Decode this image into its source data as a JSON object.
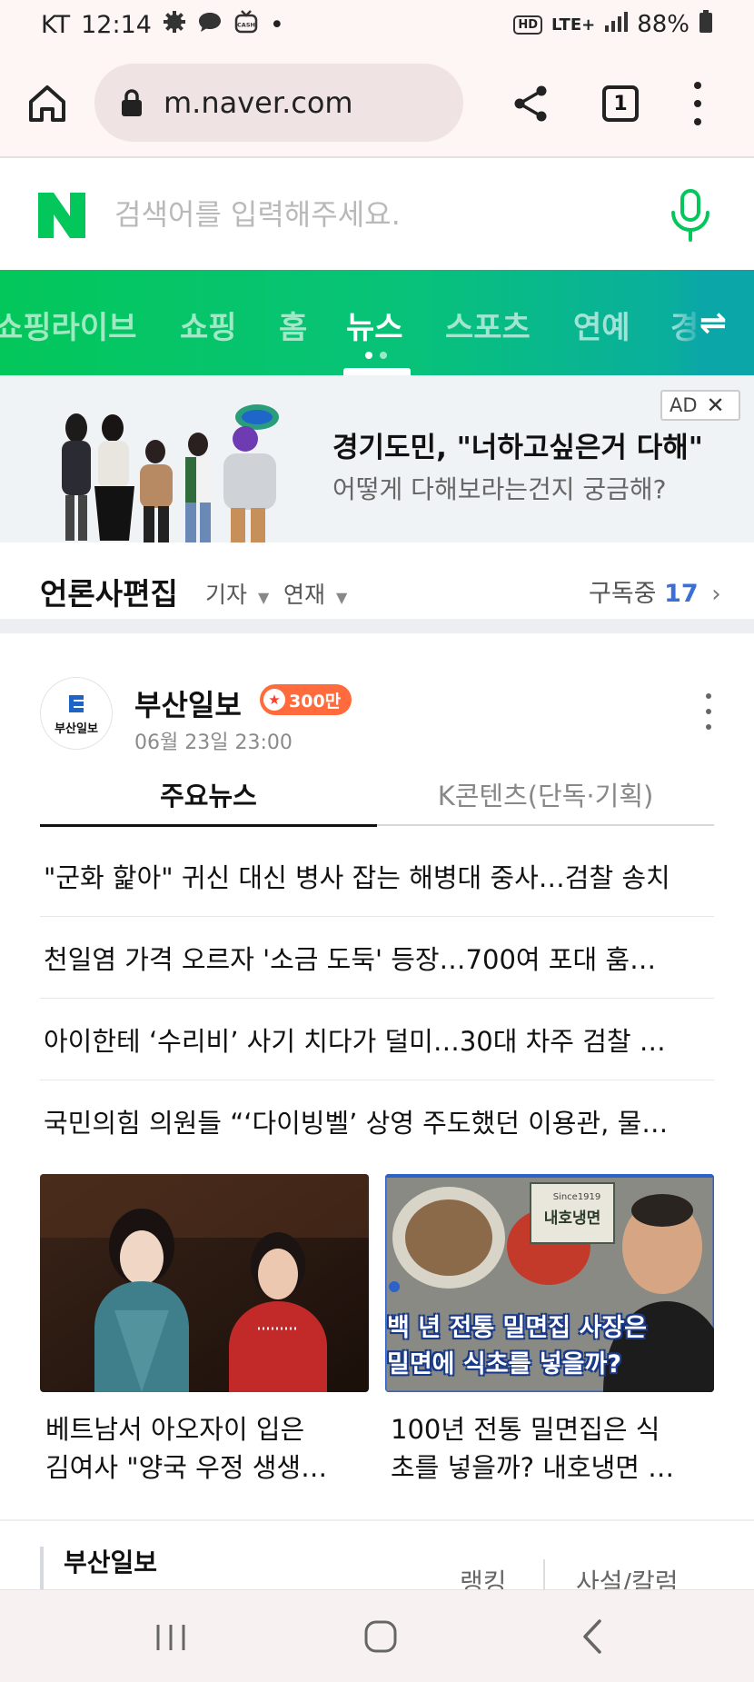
{
  "status_bar": {
    "carrier": "KT",
    "time": "12:14",
    "indicator_icons": [
      "gear-icon",
      "chat-icon",
      "cash-tv-icon"
    ],
    "notification_dot": "•",
    "hd_badge": "HD",
    "network": "LTE+",
    "battery": "88%"
  },
  "browser": {
    "url": "m.naver.com",
    "tab_count": "1"
  },
  "search": {
    "placeholder": "검색어를 입력해주세요."
  },
  "nav": {
    "items": [
      {
        "label": "쇼핑라이브",
        "active": false
      },
      {
        "label": "쇼핑",
        "active": false
      },
      {
        "label": "홈",
        "active": false
      },
      {
        "label": "뉴스",
        "active": true
      },
      {
        "label": "스포츠",
        "active": false
      },
      {
        "label": "연예",
        "active": false
      },
      {
        "label": "경",
        "active": false
      }
    ],
    "swap_icon": "⇌"
  },
  "ad": {
    "badge": "AD",
    "close": "✕",
    "title": "경기도민, \"너하고싶은거 다해\"",
    "subtitle": "어떻게 다해보라는건지 궁금해?"
  },
  "press_edit": {
    "title": "언론사편집",
    "filter_reporter": "기자",
    "filter_series": "연재",
    "subscribed_label": "구독중",
    "subscribed_count": "17"
  },
  "publisher": {
    "name": "부산일보",
    "logo_text": "부산일보",
    "subscriber_badge": "300만",
    "date": "06월 23일 23:00"
  },
  "news_tabs": [
    {
      "label": "주요뉴스",
      "active": true
    },
    {
      "label": "K콘텐츠(단독·기획)",
      "active": false
    }
  ],
  "headlines": [
    "\"군화 핥아\" 귀신 대신 병사 잡는 해병대 중사…검찰 송치",
    "천일염 가격 오르자 '소금 도둑' 등장…700여 포대 훔…",
    "아이한테 ‘수리비’ 사기 치다가 덜미…30대 차주 검찰 …",
    "국민의힘 의원들 “‘다이빙벨’ 상영 주도했던 이용관, 물…"
  ],
  "cards": [
    {
      "caption_line1": "베트남서 아오자이 입은",
      "caption_line2": "김여사 \"양국 우정 생생…"
    },
    {
      "caption_line1": "100년 전통 밀면집은 식",
      "caption_line2": "초를 넣을까? 내호냉면 …",
      "img_sign": "내호냉면",
      "img_since": "Since1919",
      "img_overlay_line1": "백 년 전통 밀면집 사장은",
      "img_overlay_line2": "밀면에 식초를 넣을까?"
    }
  ],
  "bottom_section": {
    "title": "부산일보",
    "tabs": [
      "랭킹",
      "사설/칼럼"
    ]
  },
  "colors": {
    "naver_green": "#03c75a",
    "nav_gradient_end": "#0aa8a8",
    "subscribed_count": "#3a6fd6",
    "badge_orange": "#ff6b3d"
  }
}
